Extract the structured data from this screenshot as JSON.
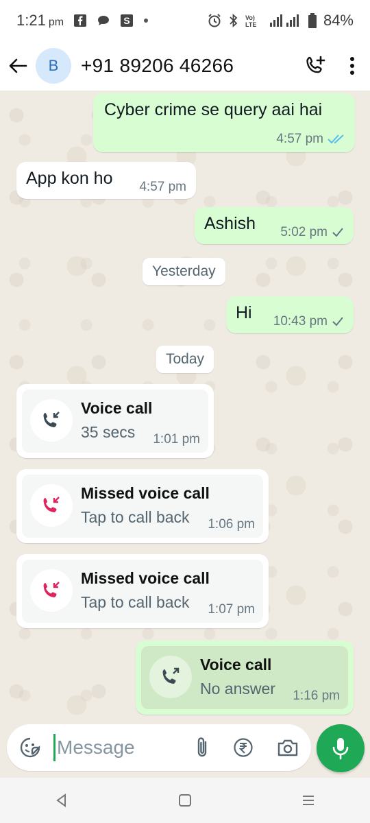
{
  "status_bar": {
    "time": "1:21",
    "ampm": "pm",
    "battery": "84%"
  },
  "header": {
    "avatar_letter": "B",
    "contact": "+91 89206 46266"
  },
  "messages": [
    {
      "text": "Cyber crime  se query aai hai",
      "time": "4:57 pm"
    },
    {
      "text": "App kon ho",
      "time": "4:57 pm"
    },
    {
      "text": "Ashish",
      "time": "5:02 pm"
    },
    {
      "text": "Hi",
      "time": "10:43 pm"
    }
  ],
  "dates": {
    "yesterday": "Yesterday",
    "today": "Today"
  },
  "calls": [
    {
      "title": "Voice call",
      "sub": "35 secs",
      "time": "1:01 pm"
    },
    {
      "title": "Missed voice call",
      "sub": "Tap to call back",
      "time": "1:06 pm"
    },
    {
      "title": "Missed voice call",
      "sub": "Tap to call back",
      "time": "1:07 pm"
    },
    {
      "title": "Voice call",
      "sub": "No answer",
      "time": "1:16 pm"
    }
  ],
  "composer": {
    "placeholder": "Message"
  },
  "colors": {
    "accent_green": "#1fa855",
    "outgoing_bubble": "#d9fdd3",
    "missed_red": "#e0245e",
    "read_tick_blue": "#53bdeb"
  }
}
